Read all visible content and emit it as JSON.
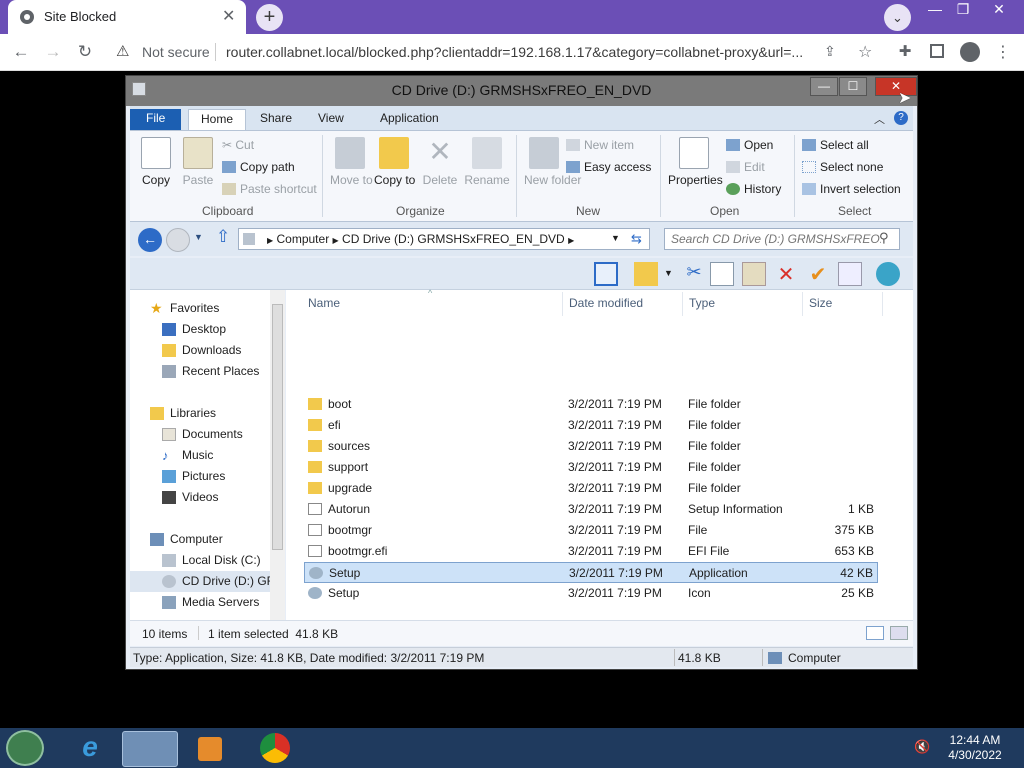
{
  "browser": {
    "tab_title": "Site Blocked",
    "tab_close": "✕",
    "new_tab": "+",
    "security_label": "Not secure",
    "url": "router.collabnet.local/blocked.php?clientaddr=192.168.1.17&category=collabnet-proxy&url=...",
    "window_controls": {
      "minimize": "—",
      "restore": "❐",
      "close": "✕"
    }
  },
  "window": {
    "title": "CD Drive (D:) GRMSHSxFREO_EN_DVD",
    "ribbon_tabs": [
      "File",
      "Home",
      "Share",
      "View",
      "Application"
    ],
    "groups": {
      "clipboard": {
        "label": "Clipboard",
        "copy": "Copy",
        "paste": "Paste",
        "cut": "Cut",
        "copy_path": "Copy path",
        "paste_shortcut": "Paste shortcut"
      },
      "organize": {
        "label": "Organize",
        "move_to": "Move to",
        "copy_to": "Copy to",
        "delete": "Delete",
        "rename": "Rename"
      },
      "new": {
        "label": "New",
        "new_folder": "New folder",
        "new_item": "New item",
        "easy_access": "Easy access"
      },
      "open": {
        "label": "Open",
        "properties": "Properties",
        "open": "Open",
        "edit": "Edit",
        "history": "History"
      },
      "select": {
        "label": "Select",
        "select_all": "Select all",
        "select_none": "Select none",
        "invert_selection": "Invert selection"
      }
    },
    "address": {
      "crumb1": "Computer",
      "crumb2": "CD Drive (D:) GRMSHSxFREO_EN_DVD"
    },
    "search_placeholder": "Search CD Drive (D:) GRMSHSxFREO...",
    "nav": {
      "favorites": "Favorites",
      "desktop": "Desktop",
      "downloads": "Downloads",
      "recent_places": "Recent Places",
      "libraries": "Libraries",
      "documents": "Documents",
      "music": "Music",
      "pictures": "Pictures",
      "videos": "Videos",
      "computer": "Computer",
      "local_disk": "Local Disk (C:)",
      "cd_drive": "CD Drive (D:) GRM",
      "media_servers": "Media Servers"
    },
    "columns": {
      "name": "Name",
      "date": "Date modified",
      "type": "Type",
      "size": "Size"
    },
    "files": [
      {
        "name": "boot",
        "date": "3/2/2011 7:19 PM",
        "type": "File folder",
        "size": ""
      },
      {
        "name": "efi",
        "date": "3/2/2011 7:19 PM",
        "type": "File folder",
        "size": ""
      },
      {
        "name": "sources",
        "date": "3/2/2011 7:19 PM",
        "type": "File folder",
        "size": ""
      },
      {
        "name": "support",
        "date": "3/2/2011 7:19 PM",
        "type": "File folder",
        "size": ""
      },
      {
        "name": "upgrade",
        "date": "3/2/2011 7:19 PM",
        "type": "File folder",
        "size": ""
      },
      {
        "name": "Autorun",
        "date": "3/2/2011 7:19 PM",
        "type": "Setup Information",
        "size": "1 KB"
      },
      {
        "name": "bootmgr",
        "date": "3/2/2011 7:19 PM",
        "type": "File",
        "size": "375 KB"
      },
      {
        "name": "bootmgr.efi",
        "date": "3/2/2011 7:19 PM",
        "type": "EFI File",
        "size": "653 KB"
      },
      {
        "name": "Setup",
        "date": "3/2/2011 7:19 PM",
        "type": "Application",
        "size": "42 KB"
      },
      {
        "name": "Setup",
        "date": "3/2/2011 7:19 PM",
        "type": "Icon",
        "size": "25 KB"
      }
    ],
    "status": {
      "item_count": "10 items",
      "selected": "1 item selected  41.8 KB",
      "details": "Type: Application, Size: 41.8 KB, Date modified: 3/2/2011 7:19 PM",
      "size": "41.8 KB",
      "location": "Computer"
    }
  },
  "taskbar": {
    "time": "12:44 AM",
    "date": "4/30/2022"
  },
  "colors": {
    "chrome_frame": "#6b4fb6",
    "ribbon_file_tab": "#1c5fb2",
    "selection": "#cde2f8",
    "taskbar": "#1f3a5e"
  }
}
